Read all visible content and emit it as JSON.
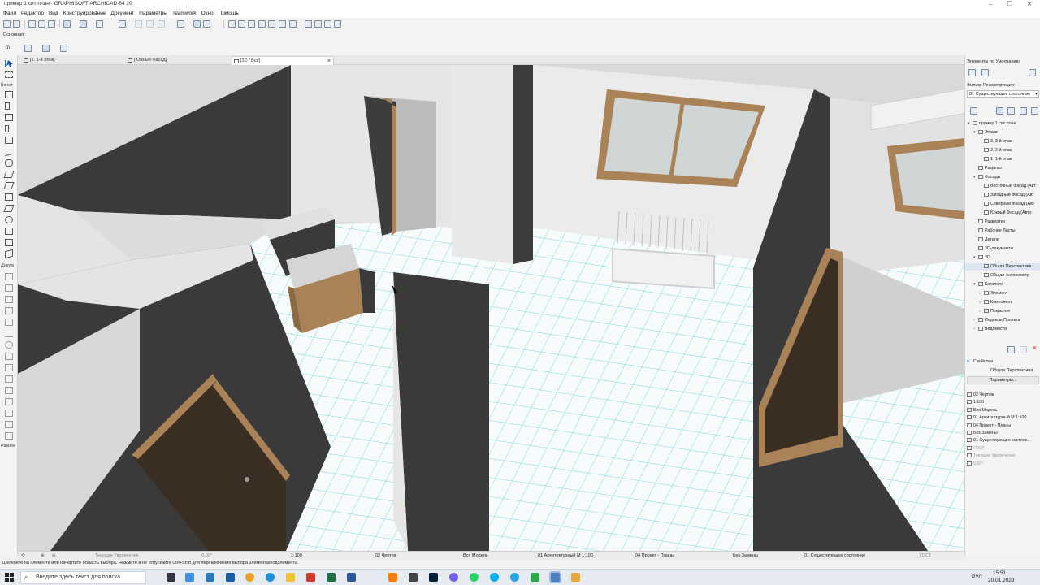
{
  "window": {
    "title": "пример 1 сит план - GRAPHISOFT ARCHICAD-64 20",
    "controls": [
      "–",
      "❐",
      "✕"
    ]
  },
  "menu": [
    "Файл",
    "Редактор",
    "Вид",
    "Конструирование",
    "Документ",
    "Параметры",
    "Teamwork",
    "Окно",
    "Помощь"
  ],
  "toolbar": {
    "info_label": "Основная",
    "layer_label": "p\\"
  },
  "tabs": [
    {
      "label": "[1. 1-й этаж]",
      "active": false
    },
    {
      "label": "[Южный Фасад]",
      "active": false
    },
    {
      "label": "[3D / Все]",
      "active": true,
      "close": "×"
    }
  ],
  "toolbox": {
    "headers": [
      "Конст",
      "Докум",
      "Разное"
    ]
  },
  "right_panel": {
    "favorites_label": "Элементы по Умолчанию",
    "filter_label": "Фильтр Реконструкции:",
    "filter_value": "01 Существующее состояние",
    "navigator": [
      {
        "label": "пример 1 сит план",
        "indent": 0,
        "arrow": "▾"
      },
      {
        "label": "Этажи",
        "indent": 1,
        "arrow": "▾"
      },
      {
        "label": "3. 3-й этаж",
        "indent": 2,
        "arrow": ""
      },
      {
        "label": "2. 2-й этаж",
        "indent": 2,
        "arrow": ""
      },
      {
        "label": "1. 1-й этаж",
        "indent": 2,
        "arrow": ""
      },
      {
        "label": "Разрезы",
        "indent": 1,
        "arrow": ""
      },
      {
        "label": "Фасады",
        "indent": 1,
        "arrow": "▾"
      },
      {
        "label": "Восточный Фасад (Авт",
        "indent": 2,
        "arrow": ""
      },
      {
        "label": "Западный Фасад (Авт",
        "indent": 2,
        "arrow": ""
      },
      {
        "label": "Северный Фасад (Авт",
        "indent": 2,
        "arrow": ""
      },
      {
        "label": "Южный Фасад (Авто",
        "indent": 2,
        "arrow": ""
      },
      {
        "label": "Развертки",
        "indent": 1,
        "arrow": ""
      },
      {
        "label": "Рабочие Листы",
        "indent": 1,
        "arrow": ""
      },
      {
        "label": "Детали",
        "indent": 1,
        "arrow": ""
      },
      {
        "label": "3D-документы",
        "indent": 1,
        "arrow": ""
      },
      {
        "label": "3D",
        "indent": 1,
        "arrow": "▾"
      },
      {
        "label": "Общая Перспектива",
        "indent": 2,
        "arrow": "",
        "selected": true
      },
      {
        "label": "Общая Аксонометр",
        "indent": 2,
        "arrow": ""
      },
      {
        "label": "Каталоги",
        "indent": 1,
        "arrow": "▾"
      },
      {
        "label": "Элемент",
        "indent": 2,
        "arrow": "›"
      },
      {
        "label": "Компонент",
        "indent": 2,
        "arrow": "›"
      },
      {
        "label": "Покрытие",
        "indent": 2,
        "arrow": "›"
      },
      {
        "label": "Индексы Проекта",
        "indent": 1,
        "arrow": "›"
      },
      {
        "label": "Ведомости",
        "indent": 1,
        "arrow": "›"
      }
    ],
    "properties_header": "Свойства",
    "properties_name": "Общая Перспектива",
    "params_button": "Параметры...",
    "properties": [
      "02 Чертеж",
      "1:100",
      "Вся Модель",
      "01 Архитектурный М 1:100",
      "04 Проект - Планы",
      "Без Замены",
      "01 Существующее состоян...",
      "ГОСТ",
      "Текущее Увеличение",
      "0,00°"
    ]
  },
  "view_status": {
    "zoom": "Текущее Увеличение",
    "angle": "0,00°",
    "scale": "1:100",
    "layer_combo": "02 Чертеж",
    "model": "Вся Модель",
    "pen_set": "01 Архитектурный М 1:100",
    "model_view": "04 Проект - Планы",
    "override": "Без Замены",
    "renovation": "01 Существующее состояние",
    "dimension": "ГОСТ"
  },
  "status_message": "Щелкните на элементе или начертите область выбора. Нажмите и не отпускайте Ctrl+Shift для переключения выбора элемента/подэлемента.",
  "taskbar": {
    "search_placeholder": "Введите здесь текст для поиска",
    "time": "15:51",
    "date": "20.01.2023",
    "lang": "РУС"
  },
  "colors": {
    "wall_dark": "#3a3a3a",
    "wall_light": "#e4e4e4",
    "floor": "#f7fbfb",
    "floor_grid": "#6fd6dc",
    "wood": "#a98257",
    "accent": "#2c6fc6"
  }
}
